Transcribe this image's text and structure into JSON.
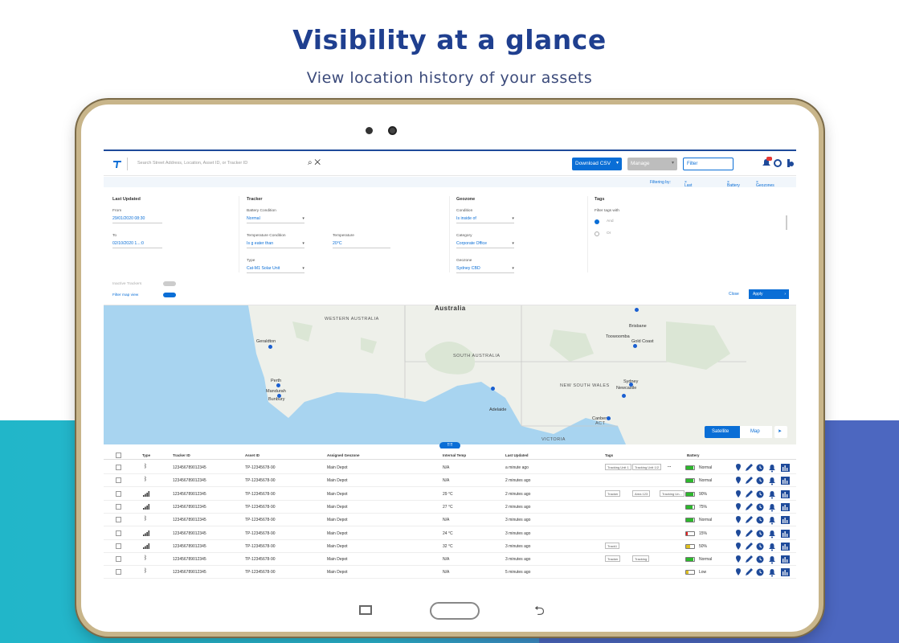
{
  "headline": "Visibility at a glance",
  "subline": "View location history of your assets",
  "app": {
    "search_placeholder": "Search Street  Address, Location,  Asset ID,  or  Tracker ID",
    "download_csv": "Download CSV",
    "manage": "Manage",
    "filter_placeholder": "Filter",
    "notification_count": "10"
  },
  "filtering": {
    "label": "Filtering by:",
    "chips": [
      "Last Updated",
      "Battery",
      "Geozones"
    ]
  },
  "panel": {
    "last_updated": {
      "heading": "Last Updated",
      "from_label": "From",
      "from_value": "29/01/2020 08:30",
      "to_label": "To",
      "to_value": "02/10/2020 1...:0"
    },
    "tracker": {
      "heading": "Tracker",
      "battery_label": "Battery Condition",
      "battery_value": "Normal",
      "temp_cond_label": "Temperature Condition",
      "temp_cond_value": "Is g eater than",
      "temp_label": "Temperature",
      "temp_value": "20°C",
      "type_label": "Type",
      "type_value": "Cat-M1 Solar Unit"
    },
    "geozone": {
      "heading": "Geozone",
      "condition_label": "Condition",
      "condition_value": "Is inside of",
      "category_label": "Category",
      "category_value": "Corporate Office",
      "geozone_label": "Geozone",
      "geozone_value": "Sydney CBD"
    },
    "tags": {
      "heading": "Tags",
      "filter_label": "Filter tags with",
      "opt_and": "And",
      "opt_or": "Or"
    },
    "inactive_trackers": "Inactive Trackers",
    "filter_map_view": "Filter map view",
    "close": "Close",
    "apply": "Apply"
  },
  "map": {
    "regions": [
      "Australia",
      "WESTERN AUSTRALIA",
      "SOUTH AUSTRALIA",
      "NEW SOUTH WALES",
      "VICTORIA",
      "ACT"
    ],
    "cities": [
      "Geraldton",
      "Perth",
      "Mandurah",
      "Bunbury",
      "Adelaide",
      "Brisbane",
      "Toowoomba",
      "Gold Coast",
      "Sydney",
      "Newcastle",
      "Canberra"
    ],
    "btn_satellite": "Satellite",
    "btn_map": "Map"
  },
  "table": {
    "headers": [
      "Type",
      "Tracker ID",
      "Asset ID",
      "Assigned Geozone",
      "Internal Temp",
      "Last Updated",
      "Tags",
      "Battery"
    ],
    "rows": [
      {
        "type": "bt",
        "tracker": "123456789012345",
        "asset": "TP-12345678-90",
        "geozone": "Main Depot",
        "temp": "N/A",
        "updated": "a minute ago",
        "tags": [
          "Tracking Unit 1",
          "Tracking Unit 1/2"
        ],
        "more": "...",
        "battery": "Normal",
        "bat_level": 0.9,
        "bat_color": "#2db82d"
      },
      {
        "type": "bt",
        "tracker": "123456789012345",
        "asset": "TP-12345678-90",
        "geozone": "Main Depot",
        "temp": "N/A",
        "updated": "2 minutes ago",
        "tags": [],
        "more": "",
        "battery": "Normal",
        "bat_level": 0.9,
        "bat_color": "#2db82d"
      },
      {
        "type": "sig",
        "tracker": "123456789012345",
        "asset": "TP-12345678-90",
        "geozone": "Main Depot",
        "temp": "29 °C",
        "updated": "2 minutes ago",
        "tags": [
          "Tracker",
          "Area 123",
          "Tracking Un..."
        ],
        "more": "",
        "battery": "90%",
        "bat_level": 0.9,
        "bat_color": "#2db82d"
      },
      {
        "type": "sig",
        "tracker": "123456789012345",
        "asset": "TP-12345678-90",
        "geozone": "Main Depot",
        "temp": "27 °C",
        "updated": "2 minutes ago",
        "tags": [],
        "more": "",
        "battery": "75%",
        "bat_level": 0.75,
        "bat_color": "#2db82d"
      },
      {
        "type": "bt",
        "tracker": "123456789012345",
        "asset": "TP-12345678-90",
        "geozone": "Main Depot",
        "temp": "N/A",
        "updated": "3 minutes ago",
        "tags": [],
        "more": "",
        "battery": "Normal",
        "bat_level": 0.9,
        "bat_color": "#2db82d"
      },
      {
        "type": "sig",
        "tracker": "123456789012345",
        "asset": "TP-12345678-90",
        "geozone": "Main Depot",
        "temp": "24 °C",
        "updated": "3 minutes ago",
        "tags": [],
        "more": "",
        "battery": "15%",
        "bat_level": 0.15,
        "bat_color": "#e02020"
      },
      {
        "type": "sig",
        "tracker": "123456789012345",
        "asset": "TP-12345678-90",
        "geozone": "Main Depot",
        "temp": "32 °C",
        "updated": "3 minutes ago",
        "tags": [
          "Track1"
        ],
        "more": "",
        "battery": "50%",
        "bat_level": 0.5,
        "bat_color": "#e0c020"
      },
      {
        "type": "bt",
        "tracker": "123456789012345",
        "asset": "TP-12345678-90",
        "geozone": "Main Depot",
        "temp": "N/A",
        "updated": "3 minutes ago",
        "tags": [
          "Tracker",
          "Tracking"
        ],
        "more": "",
        "battery": "Normal",
        "bat_level": 0.9,
        "bat_color": "#2db82d"
      },
      {
        "type": "bt",
        "tracker": "123456789012345",
        "asset": "TP-12345678-90",
        "geozone": "Main Depot",
        "temp": "N/A",
        "updated": "5 minutes ago",
        "tags": [],
        "more": "",
        "battery": "Low",
        "bat_level": 0.3,
        "bat_color": "#e0c020"
      }
    ]
  },
  "colors": {
    "brand": "#0a6ed6",
    "headline": "#1f3f8f",
    "teal": "#21b6c9",
    "indigo": "#4c67c0"
  }
}
